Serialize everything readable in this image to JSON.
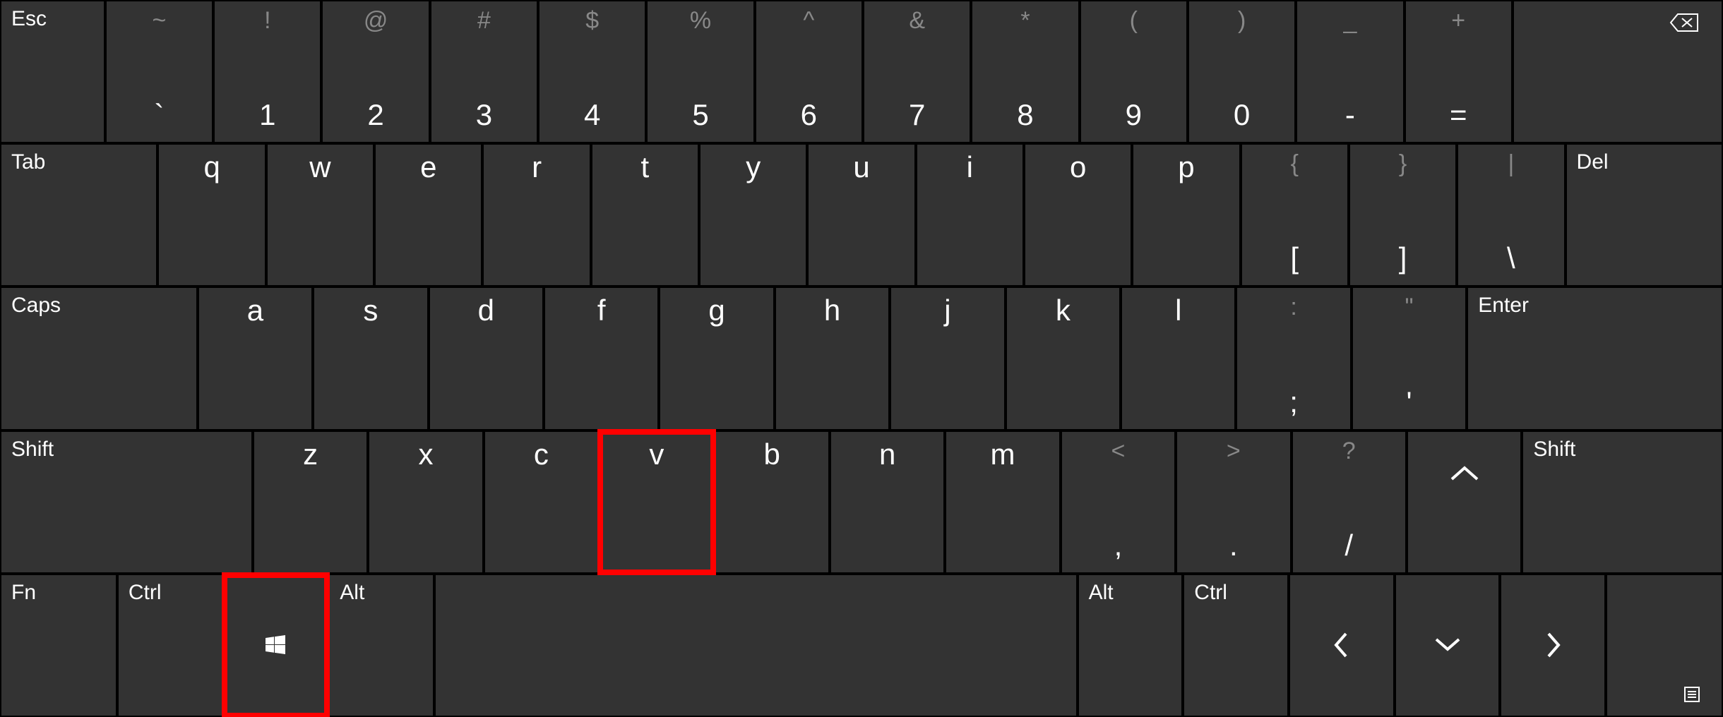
{
  "row1": {
    "esc": "Esc",
    "keys": [
      {
        "shift": "~",
        "main": "`"
      },
      {
        "shift": "!",
        "main": "1"
      },
      {
        "shift": "@",
        "main": "2"
      },
      {
        "shift": "#",
        "main": "3"
      },
      {
        "shift": "$",
        "main": "4"
      },
      {
        "shift": "%",
        "main": "5"
      },
      {
        "shift": "^",
        "main": "6"
      },
      {
        "shift": "&",
        "main": "7"
      },
      {
        "shift": "*",
        "main": "8"
      },
      {
        "shift": "(",
        "main": "9"
      },
      {
        "shift": ")",
        "main": "0"
      },
      {
        "shift": "_",
        "main": "-"
      },
      {
        "shift": "+",
        "main": "="
      }
    ]
  },
  "row2": {
    "tab": "Tab",
    "letters": [
      "q",
      "w",
      "e",
      "r",
      "t",
      "y",
      "u",
      "i",
      "o",
      "p"
    ],
    "brackets": [
      {
        "shift": "{",
        "main": "["
      },
      {
        "shift": "}",
        "main": "]"
      },
      {
        "shift": "|",
        "main": "\\"
      }
    ],
    "del": "Del"
  },
  "row3": {
    "caps": "Caps",
    "letters": [
      "a",
      "s",
      "d",
      "f",
      "g",
      "h",
      "j",
      "k",
      "l"
    ],
    "punct": [
      {
        "shift": ":",
        "main": ";"
      },
      {
        "shift": "\"",
        "main": "'"
      }
    ],
    "enter": "Enter"
  },
  "row4": {
    "shiftL": "Shift",
    "letters": [
      "z",
      "x",
      "c",
      "v",
      "b",
      "n",
      "m"
    ],
    "punct": [
      {
        "shift": "<",
        "main": ","
      },
      {
        "shift": ">",
        "main": "."
      },
      {
        "shift": "?",
        "main": "/"
      }
    ],
    "caret": "︿",
    "shiftR": "Shift"
  },
  "row5": {
    "fn": "Fn",
    "ctrlL": "Ctrl",
    "altL": "Alt",
    "altR": "Alt",
    "ctrlR": "Ctrl"
  },
  "highlighted_keys": [
    "v",
    "win"
  ],
  "colors": {
    "key_bg": "#333333",
    "text": "#ffffff",
    "dim": "#888888",
    "highlight": "#ff0000"
  }
}
